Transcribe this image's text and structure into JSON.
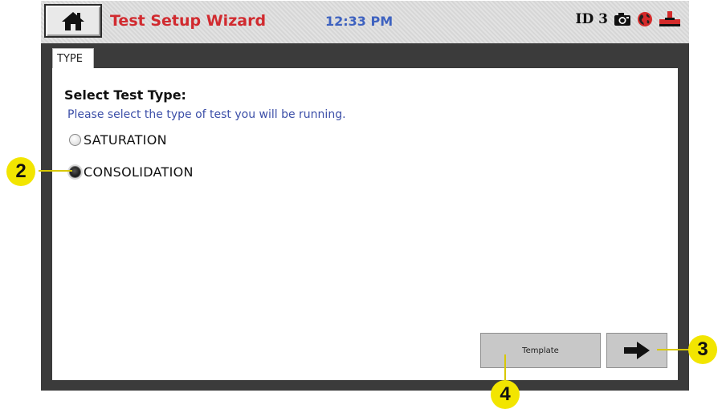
{
  "titlebar": {
    "title": "Test Setup Wizard",
    "time": "12:33 PM",
    "id_label": "ID 3",
    "icons": [
      "home-icon",
      "camera-icon",
      "network-globe-icon",
      "valve-icon"
    ],
    "colors": {
      "title": "#d12a2f",
      "time": "#3e62c0"
    }
  },
  "tabs": [
    {
      "label": "TYPE"
    }
  ],
  "content": {
    "heading": "Select Test Type:",
    "subheading": "Please select the type of test you will be running.",
    "options": [
      {
        "label": "SATURATION",
        "selected": false
      },
      {
        "label": "CONSOLIDATION",
        "selected": true
      }
    ]
  },
  "buttons": {
    "template": "Template",
    "next_icon": "arrow-right-icon"
  },
  "callouts": [
    "2",
    "3",
    "4"
  ]
}
